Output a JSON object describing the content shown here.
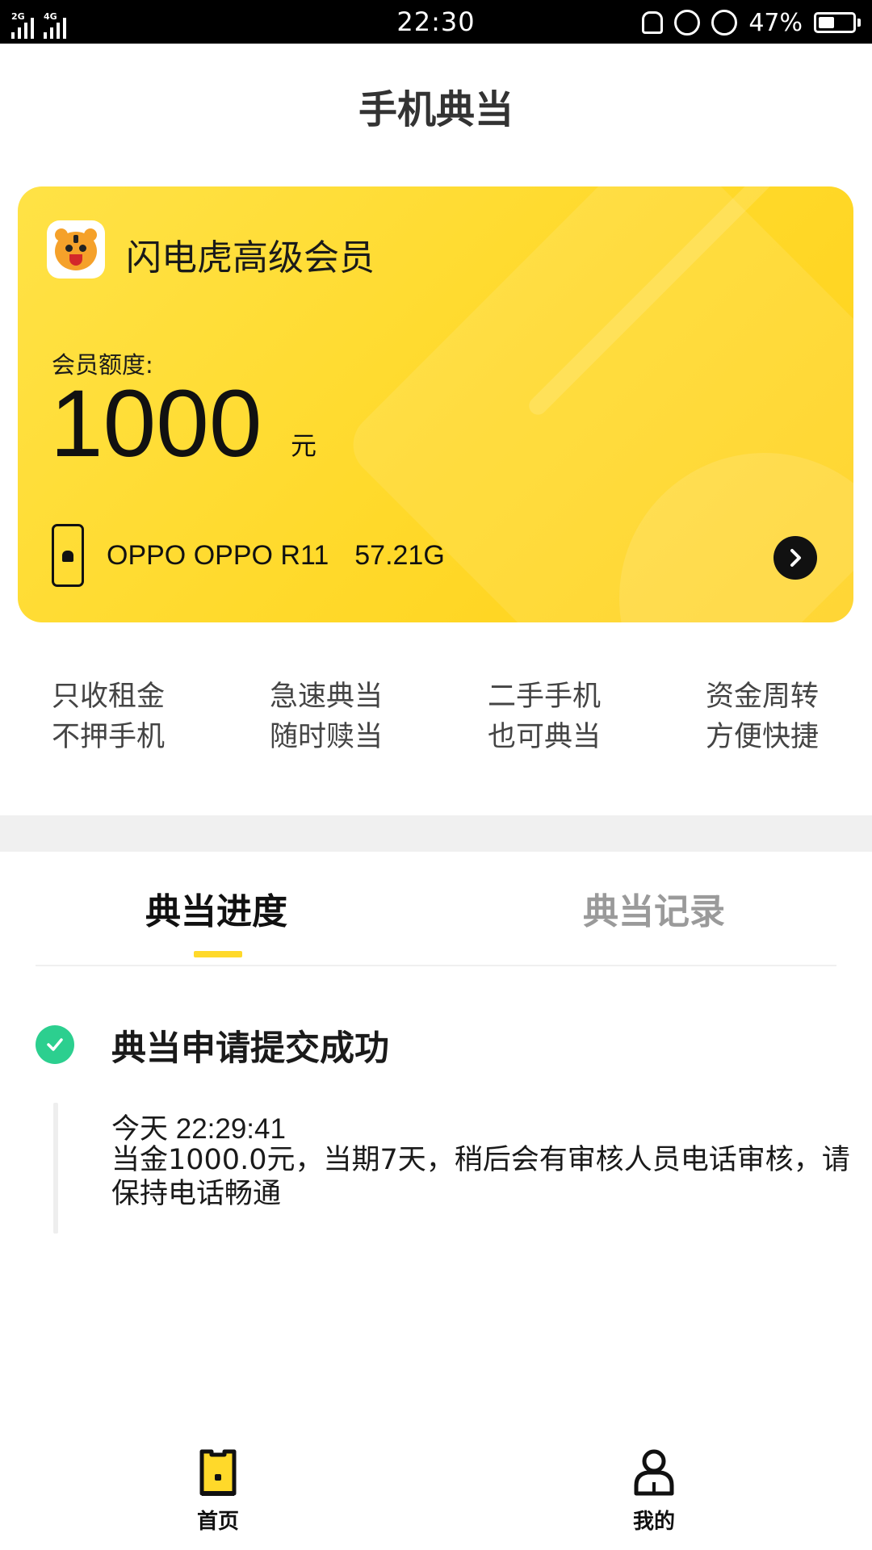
{
  "status_bar": {
    "sim1_tag": "2G",
    "sim2_tag": "4G",
    "time": "22:30",
    "battery": "47%",
    "battery_level": 0.47
  },
  "header": {
    "title": "手机典当"
  },
  "card": {
    "name": "闪电虎高级会员",
    "quota_label": "会员额度:",
    "quota_value": "1000",
    "quota_unit": "元",
    "device_name": "OPPO OPPO R11",
    "device_storage": "57.21G",
    "colors": {
      "start": "#ffe246",
      "end": "#ffd11a"
    }
  },
  "features": [
    {
      "line1": "只收租金",
      "line2": "不押手机"
    },
    {
      "line1": "急速典当",
      "line2": "随时赎当"
    },
    {
      "line1": "二手手机",
      "line2": "也可典当"
    },
    {
      "line1": "资金周转",
      "line2": "方便快捷"
    }
  ],
  "tabs": [
    {
      "label": "典当进度",
      "active": true
    },
    {
      "label": "典当记录",
      "active": false
    }
  ],
  "progress": {
    "title": "典当申请提交成功",
    "time": "今天 22:29:41",
    "description": "当金1000.0元，当期7天，稍后会有审核人员电话审核，请保持电话畅通",
    "status_color": "#2ccf8f"
  },
  "bottom_nav": [
    {
      "label": "首页",
      "icon": "phone-home-icon",
      "active": true
    },
    {
      "label": "我的",
      "icon": "person-icon",
      "active": false
    }
  ],
  "accent_color": "#ffd92a"
}
